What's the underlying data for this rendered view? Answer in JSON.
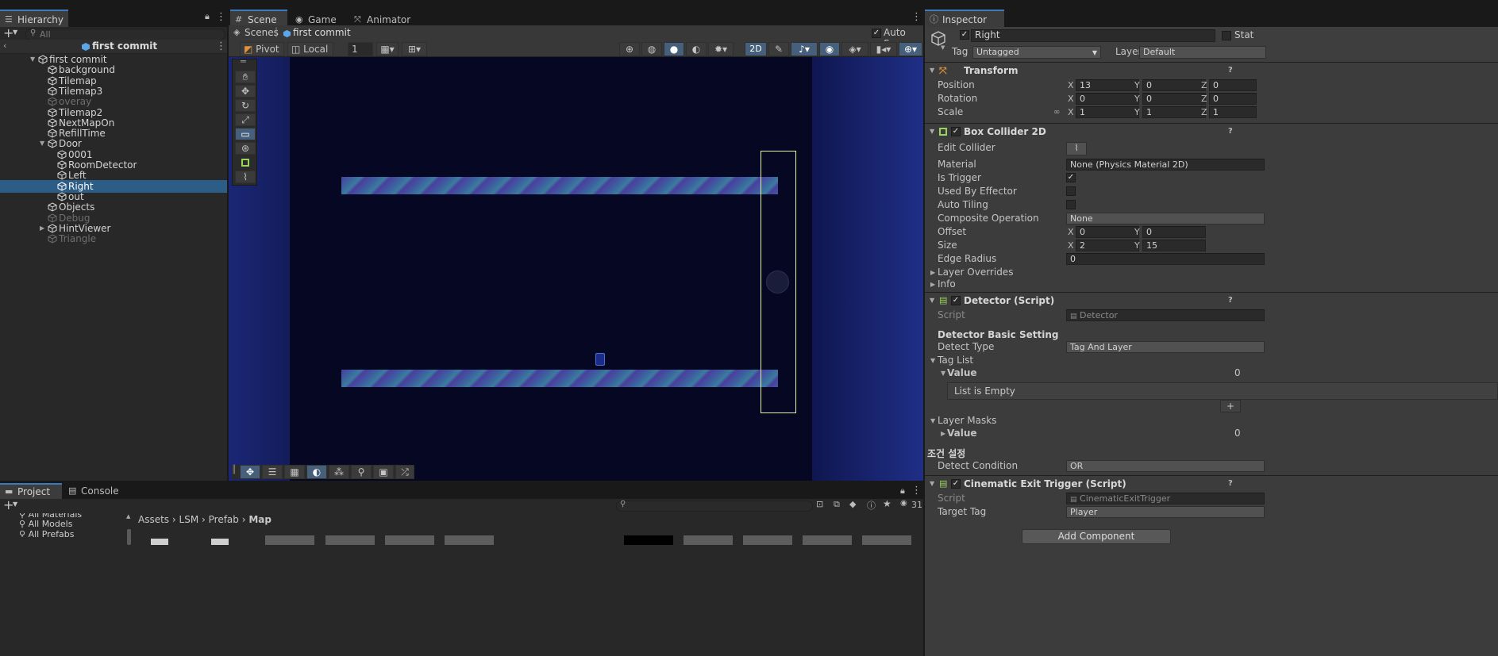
{
  "hierarchy": {
    "tab_label": "Hierarchy",
    "search_placeholder": "All",
    "scene_name": "first commit",
    "items": [
      {
        "label": "first commit",
        "depth": 1,
        "expand": "open",
        "state": "normal"
      },
      {
        "label": "background",
        "depth": 2,
        "expand": "none",
        "state": "normal"
      },
      {
        "label": "Tilemap",
        "depth": 2,
        "expand": "none",
        "state": "normal"
      },
      {
        "label": "Tilemap3",
        "depth": 2,
        "expand": "none",
        "state": "normal"
      },
      {
        "label": "overay",
        "depth": 2,
        "expand": "none",
        "state": "dim"
      },
      {
        "label": "Tilemap2",
        "depth": 2,
        "expand": "none",
        "state": "normal"
      },
      {
        "label": "NextMapOn",
        "depth": 2,
        "expand": "none",
        "state": "normal"
      },
      {
        "label": "RefillTime",
        "depth": 2,
        "expand": "none",
        "state": "normal"
      },
      {
        "label": "Door",
        "depth": 2,
        "expand": "open",
        "state": "normal"
      },
      {
        "label": "0001",
        "depth": 3,
        "expand": "none",
        "state": "normal"
      },
      {
        "label": "RoomDetector",
        "depth": 3,
        "expand": "none",
        "state": "normal"
      },
      {
        "label": "Left",
        "depth": 3,
        "expand": "none",
        "state": "normal"
      },
      {
        "label": "Right",
        "depth": 3,
        "expand": "none",
        "state": "selected"
      },
      {
        "label": "out",
        "depth": 3,
        "expand": "none",
        "state": "normal"
      },
      {
        "label": "Objects",
        "depth": 2,
        "expand": "none",
        "state": "normal"
      },
      {
        "label": "Debug",
        "depth": 2,
        "expand": "none",
        "state": "dim"
      },
      {
        "label": "HintViewer",
        "depth": 2,
        "expand": "closed",
        "state": "normal"
      },
      {
        "label": "Triangle",
        "depth": 2,
        "expand": "none",
        "state": "dim"
      }
    ]
  },
  "scene": {
    "tabs": [
      {
        "label": "Scene"
      },
      {
        "label": "Game"
      },
      {
        "label": "Animator"
      }
    ],
    "breadcrumb_root": "Scenes",
    "breadcrumb_scene": "first commit",
    "auto_save_label": "Auto Save",
    "pivot_label": "Pivot",
    "space_label": "Local",
    "grid_value": "1",
    "mode_2d_label": "2D"
  },
  "inspector": {
    "tab_label": "Inspector",
    "object_name": "Right",
    "static_label": "Stat",
    "tag_label": "Tag",
    "tag_value": "Untagged",
    "layer_label": "Layer",
    "layer_value": "Default",
    "transform": {
      "title": "Transform",
      "position_label": "Position",
      "position": [
        "13",
        "0",
        "0"
      ],
      "rotation_label": "Rotation",
      "rotation": [
        "0",
        "0",
        "0"
      ],
      "scale_label": "Scale",
      "scale": [
        "1",
        "1",
        "1"
      ]
    },
    "box_collider": {
      "title": "Box Collider 2D",
      "edit_collider_label": "Edit Collider",
      "material_label": "Material",
      "material_value": "None (Physics Material 2D)",
      "is_trigger_label": "Is Trigger",
      "used_by_effector_label": "Used By Effector",
      "auto_tiling_label": "Auto Tiling",
      "composite_label": "Composite Operation",
      "composite_value": "None",
      "offset_label": "Offset",
      "offset": [
        "0",
        "0"
      ],
      "size_label": "Size",
      "size": [
        "2",
        "15"
      ],
      "edge_radius_label": "Edge Radius",
      "edge_radius_value": "0",
      "layer_overrides_label": "Layer Overrides",
      "info_label": "Info"
    },
    "detector": {
      "title": "Detector (Script)",
      "script_label": "Script",
      "script_value": "Detector",
      "basic_setting_label": "Detector Basic Setting",
      "detect_type_label": "Detect Type",
      "detect_type_value": "Tag And Layer",
      "tag_list_label": "Tag List",
      "value_label": "Value",
      "value_count": "0",
      "list_empty_label": "List is Empty",
      "add_item": "+",
      "layer_masks_label": "Layer Masks",
      "layer_value_label": "Value",
      "layer_value_count": "0",
      "condition_header": "조건 설정",
      "detect_condition_label": "Detect Condition",
      "detect_condition_value": "OR"
    },
    "cinematic": {
      "title": "Cinematic Exit Trigger (Script)",
      "script_label": "Script",
      "script_value": "CinematicExitTrigger",
      "target_tag_label": "Target Tag",
      "target_tag_value": "Player"
    },
    "add_component_label": "Add Component",
    "axis_x": "X",
    "axis_y": "Y",
    "axis_z": "Z"
  },
  "project": {
    "tabs": [
      {
        "label": "Project"
      },
      {
        "label": "Console"
      }
    ],
    "folders": [
      "All Materials",
      "All Models",
      "All Prefabs"
    ],
    "breadcrumb": [
      "Assets",
      "LSM",
      "Prefab",
      "Map"
    ],
    "hidden_count": "31"
  }
}
